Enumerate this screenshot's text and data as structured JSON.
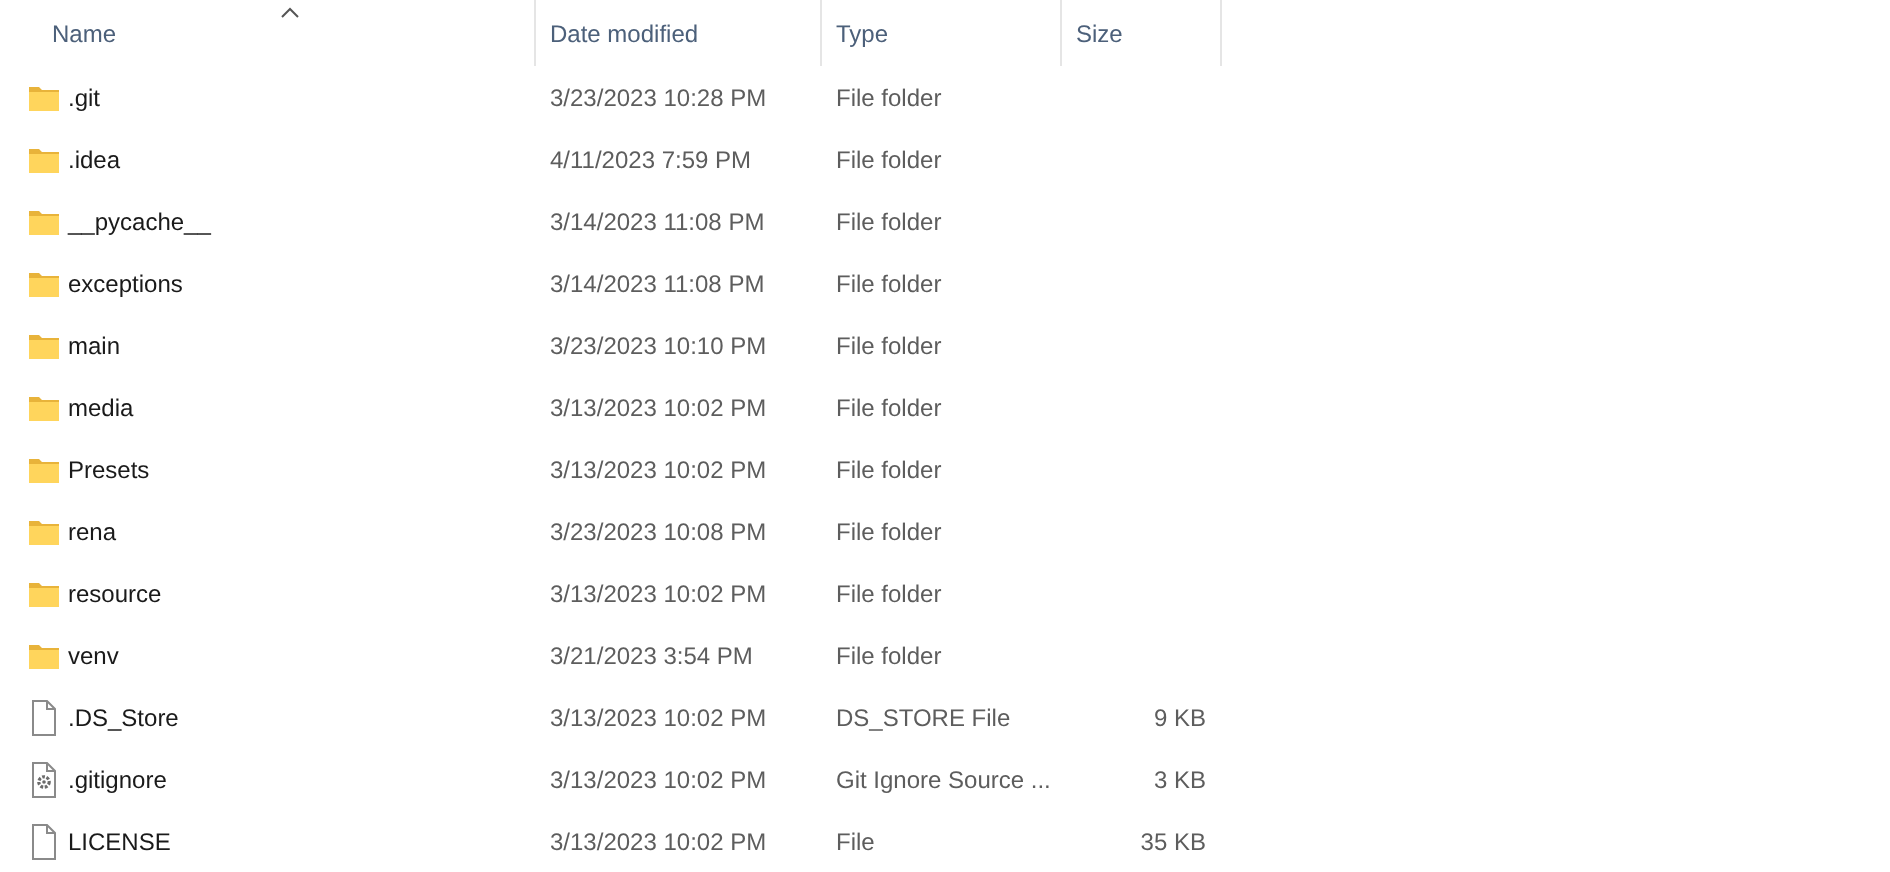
{
  "columns": [
    {
      "label": "Name",
      "sorted": true
    },
    {
      "label": "Date modified",
      "sorted": false
    },
    {
      "label": "Type",
      "sorted": false
    },
    {
      "label": "Size",
      "sorted": false
    }
  ],
  "rows": [
    {
      "kind": "folder",
      "name": ".git",
      "date": "3/23/2023 10:28 PM",
      "type": "File folder"
    },
    {
      "kind": "folder",
      "name": ".idea",
      "date": "4/11/2023 7:59 PM",
      "type": "File folder"
    },
    {
      "kind": "folder",
      "name": "__pycache__",
      "date": "3/14/2023 11:08 PM",
      "type": "File folder"
    },
    {
      "kind": "folder",
      "name": "exceptions",
      "date": "3/14/2023 11:08 PM",
      "type": "File folder"
    },
    {
      "kind": "folder",
      "name": "main",
      "date": "3/23/2023 10:10 PM",
      "type": "File folder"
    },
    {
      "kind": "folder",
      "name": "media",
      "date": "3/13/2023 10:02 PM",
      "type": "File folder"
    },
    {
      "kind": "folder",
      "name": "Presets",
      "date": "3/13/2023 10:02 PM",
      "type": "File folder"
    },
    {
      "kind": "folder",
      "name": "rena",
      "date": "3/23/2023 10:08 PM",
      "type": "File folder"
    },
    {
      "kind": "folder",
      "name": "resource",
      "date": "3/13/2023 10:02 PM",
      "type": "File folder"
    },
    {
      "kind": "folder",
      "name": "venv",
      "date": "3/21/2023 3:54 PM",
      "type": "File folder"
    },
    {
      "kind": "file",
      "name": ".DS_Store",
      "date": "3/13/2023 10:02 PM",
      "type": "DS_STORE File",
      "size": "9 KB"
    },
    {
      "kind": "config",
      "name": ".gitignore",
      "date": "3/13/2023 10:02 PM",
      "type": "Git Ignore Source ...",
      "size": "3 KB"
    },
    {
      "kind": "file",
      "name": "LICENSE",
      "date": "3/13/2023 10:02 PM",
      "type": "File",
      "size": "35 KB"
    }
  ]
}
